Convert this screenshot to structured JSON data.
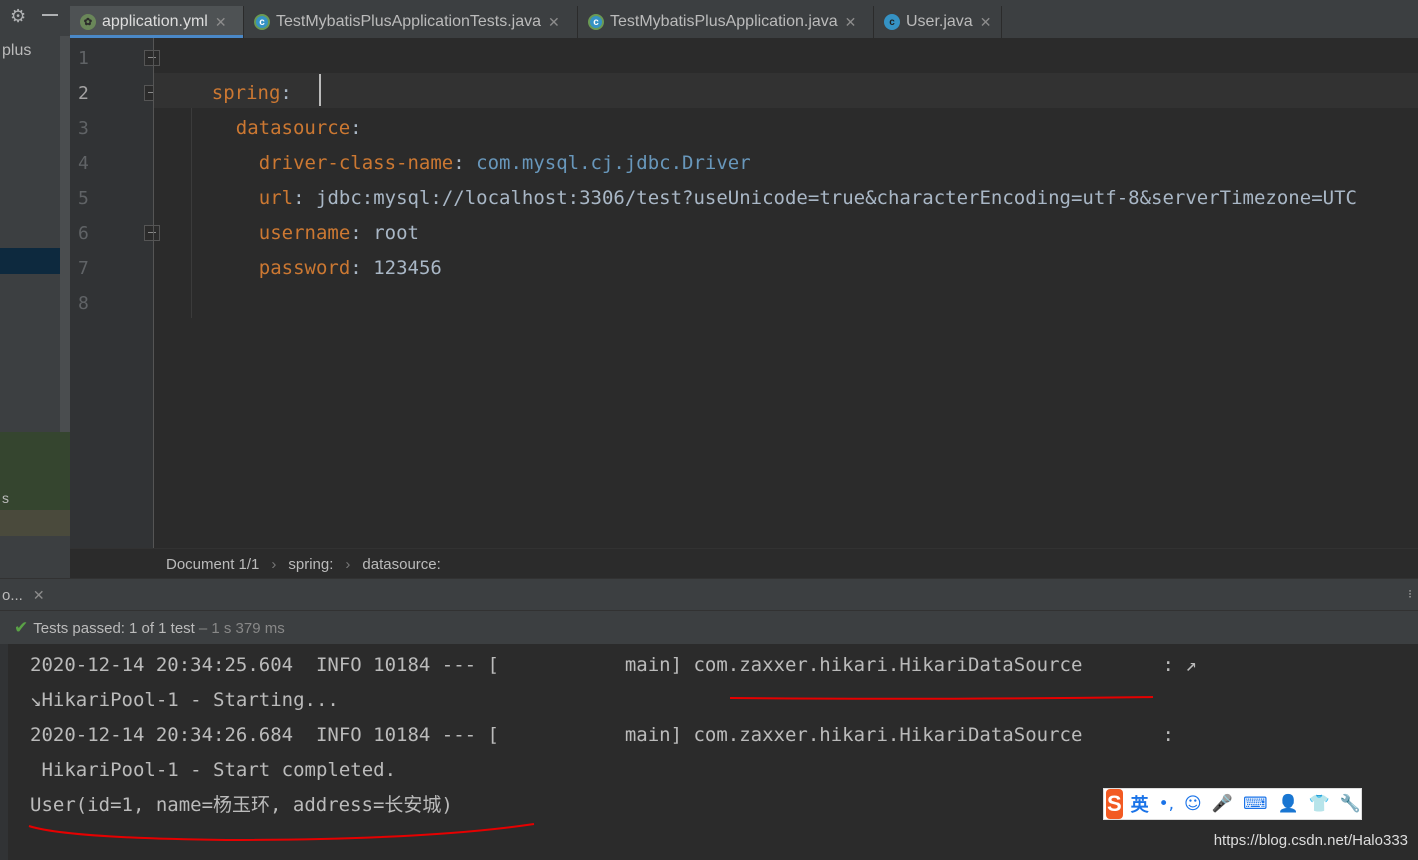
{
  "colors": {
    "keyword": "#cc7832",
    "class_value": "#6897bb",
    "success": "#5aa246",
    "accent_tab": "#4a88c7",
    "annotation": "#e60000"
  },
  "left_panel": {
    "project_label": "plus",
    "item_label": "s"
  },
  "tabs": [
    {
      "label": "application.yml",
      "icon": "yaml-leaf-icon",
      "active": true
    },
    {
      "label": "TestMybatisPlusApplicationTests.java",
      "icon": "spring-test-icon",
      "active": false
    },
    {
      "label": "TestMybatisPlusApplication.java",
      "icon": "spring-app-icon",
      "active": false
    },
    {
      "label": "User.java",
      "icon": "class-icon",
      "active": false
    }
  ],
  "editor": {
    "line_numbers": [
      "1",
      "2",
      "3",
      "4",
      "5",
      "6",
      "7",
      "8"
    ],
    "lines": [
      {
        "key": "spring",
        "colon": ":",
        "value": ""
      },
      {
        "key": "datasource",
        "colon": ":",
        "value": ""
      },
      {
        "key": "driver-class-name",
        "colon": ":",
        "value": "com.mysql.cj.jdbc.Driver"
      },
      {
        "key": "url",
        "colon": ":",
        "value": "jdbc:mysql://localhost:3306/test?useUnicode=true&characterEncoding=utf-8&serverTimezone=UTC"
      },
      {
        "key": "username",
        "colon": ":",
        "value": "root"
      },
      {
        "key": "password",
        "colon": ":",
        "value": "123456"
      }
    ]
  },
  "breadcrumb": {
    "document": "Document 1/1",
    "level1": "spring:",
    "level2": "datasource:",
    "separator": "›"
  },
  "run_panel": {
    "tab_label": "o...",
    "status_passed": "Tests passed:",
    "status_count": "1 of 1 test",
    "status_time": "– 1 s 379 ms"
  },
  "console": [
    "2020-12-14 20:34:25.604  INFO 10184 --- [           main] com.zaxxer.hikari.HikariDataSource       : ↗",
    "↘HikariPool-1 - Starting...",
    "2020-12-14 20:34:26.684  INFO 10184 --- [           main] com.zaxxer.hikari.HikariDataSource       :",
    " HikariPool-1 - Start completed.",
    "User(id=1, name=杨玉环, address=长安城)"
  ],
  "ime": {
    "logo": "S",
    "lang": "英",
    "icons": [
      "punctuation-icon",
      "emoji-icon",
      "microphone-icon",
      "keyboard-icon",
      "user-icon",
      "skin-icon",
      "settings-icon"
    ]
  },
  "watermark": "https://blog.csdn.net/Halo333"
}
